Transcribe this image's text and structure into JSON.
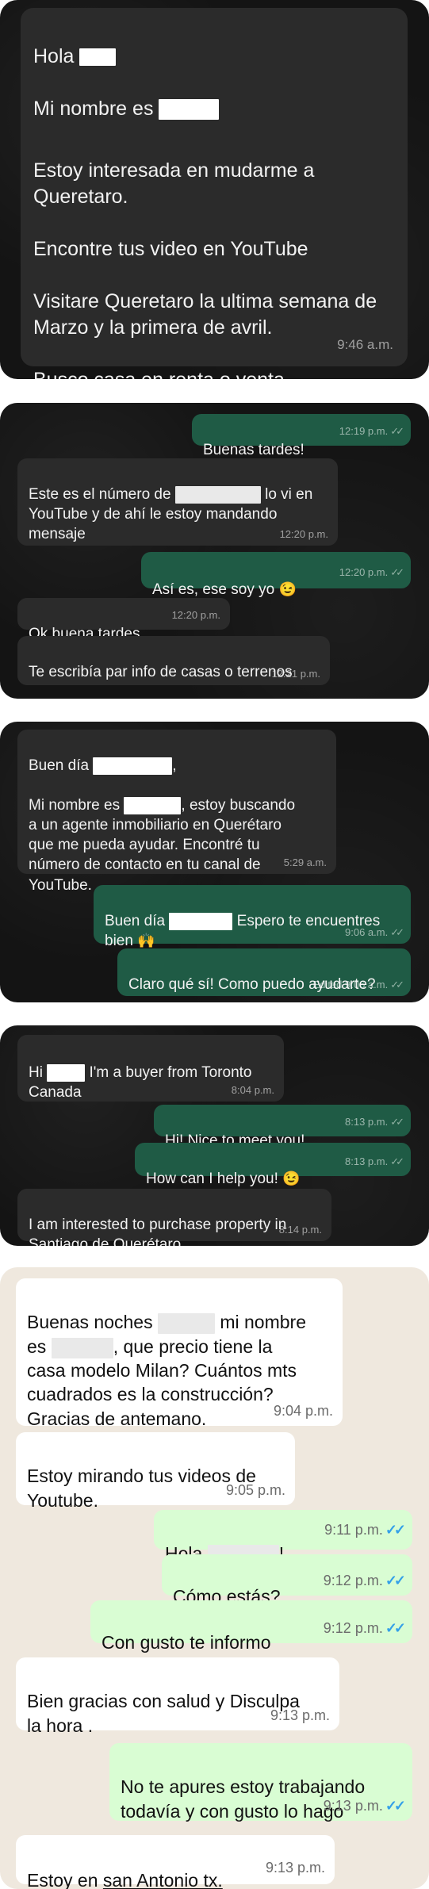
{
  "panel1": {
    "line1": "Hola",
    "line2": "Mi nombre es",
    "body": "Estoy interesada en mudarme a\nQueretaro.\n\nEncontre tus video en YouTube\n\nVisitare Queretaro la ultima semana de\nMarzo y la primera de avril.\n\nBusco casa en renta o venta\nY local industrial.",
    "time": "9:46 a.m."
  },
  "panel2": {
    "m1": {
      "text": "Buenas tardes!",
      "time": "12:19 p.m."
    },
    "m2": {
      "t1": "Este es el número de",
      "t2": "lo vi en\nYouTube y de ahí le estoy mandando\nmensaje",
      "time": "12:20 p.m."
    },
    "m3": {
      "text": "Así es, ese soy yo",
      "emoji": "😉",
      "time": "12:20 p.m."
    },
    "m4": {
      "text": "Ok buena tardes",
      "time": "12:20 p.m."
    },
    "m5": {
      "text": "Te escribía par info de casas o terrenos",
      "time": "12:21 p.m."
    }
  },
  "panel3": {
    "m1": {
      "a": "Buen día",
      "b": ",",
      "c": "Mi nombre es",
      "d": ", estoy  buscando\na un agente inmobiliario en Querétaro\nque me pueda ayudar. Encontré tu\nnúmero de contacto en tu canal de\nYouTube.",
      "time": "5:29 a.m."
    },
    "m2": {
      "a": "Buen día",
      "b": "Espero te encuentres\nbien",
      "emoji": "🙌",
      "time": "9:06 a.m."
    },
    "m3": {
      "text": "Claro qué sí! Como puedo ayudarte?",
      "time": "Edited 9:06 a.m."
    }
  },
  "panel4": {
    "m1": {
      "a": "Hi",
      "b": "I'm a buyer from Toronto\nCanada",
      "time": "8:04 p.m."
    },
    "m2": {
      "text": "Hi! Nice to meet you!",
      "time": "8:13 p.m."
    },
    "m3": {
      "text": "How can I help you!",
      "emoji": "😉",
      "time": "8:13 p.m."
    },
    "m4": {
      "text": "I am interested to purchase property in\nSantiago de Querétaro",
      "time": "8:14 p.m."
    }
  },
  "panel5": {
    "m1": {
      "a": "Buenas noches",
      "b": "mi nombre\nes",
      "c": ", que precio tiene la\ncasa modelo Milan? Cuántos mts\ncuadrados es la construcción?\nGracias de antemano.",
      "time": "9:04 p.m."
    },
    "m2": {
      "text": "Estoy mirando tus videos de\nYoutube.",
      "time": "9:05 p.m."
    },
    "m3": {
      "a": "Hola",
      "b": "!",
      "time": "9:11 p.m."
    },
    "m4": {
      "text": "Cómo estás?",
      "time": "9:12 p.m."
    },
    "m5": {
      "text": "Con gusto te informo",
      "time": "9:12 p.m."
    },
    "m6": {
      "text": "Bien gracias con salud y Disculpa\nla hora .",
      "time": "9:13 p.m."
    },
    "m7": {
      "text": "No te apures estoy trabajando\ntodavía y con gusto lo hago",
      "time": "9:13 p.m."
    },
    "m8": {
      "a": "Estoy en",
      "b": "san Antonio tx.",
      "time": "9:13 p.m."
    }
  },
  "ticks": "✓✓",
  "colors": {
    "dark_in": "#2b2b2b",
    "dark_out": "#1f5b45",
    "light_in": "#ffffff",
    "light_out": "#d9fdd3",
    "read_ticks": "#34a0e8"
  }
}
